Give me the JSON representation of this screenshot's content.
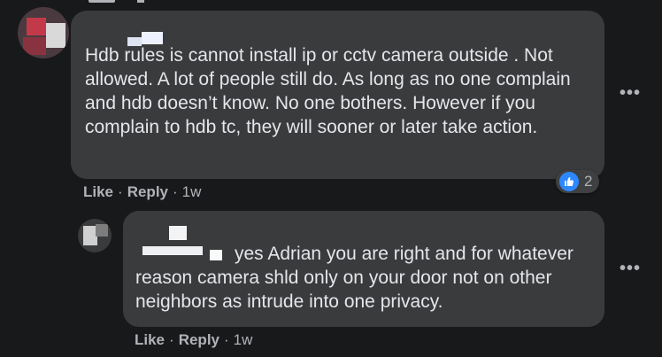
{
  "comments": [
    {
      "text": "Hdb rules is cannot install ip or cctv camera outside . Not allowed. A lot of people still do. As long as no one complain and hdb doesn’t know. No one bothers. However if you complain to hdb tc, they will sooner or later take action.",
      "reaction_count": "2",
      "actions": {
        "like": "Like",
        "reply": "Reply",
        "time": "1w"
      },
      "more_icon": "•••"
    }
  ],
  "replies": [
    {
      "text": "yes Adrian you are right and for whatever reason camera shld only on your door not on other neighbors as intrude into one privacy.",
      "actions": {
        "like": "Like",
        "reply": "Reply",
        "time": "1w"
      },
      "more_icon": "•••"
    }
  ],
  "colors": {
    "background": "#18191a",
    "bubble": "#3a3b3c",
    "text": "#e4e6eb",
    "secondary_text": "#b0b3b8",
    "like_blue": "#2d88ff"
  },
  "icons": {
    "reaction": "like-thumb-icon",
    "more": "more-options-icon"
  }
}
